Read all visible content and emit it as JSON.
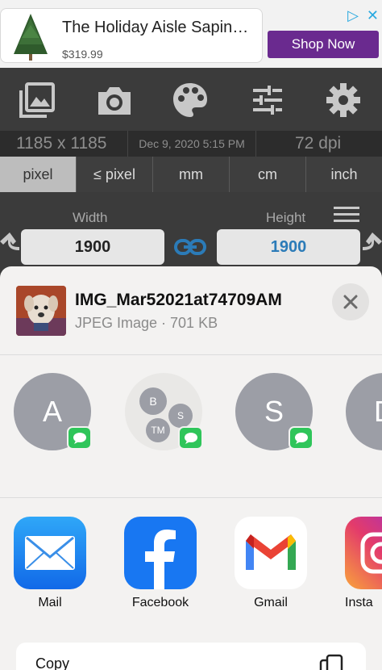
{
  "ad": {
    "title": "The Holiday Aisle Sapin…",
    "price": "$319.99",
    "cta": "Shop Now",
    "choices_icon": "adchoices-icon",
    "close_icon": "close-icon"
  },
  "toolbar": {
    "icons": [
      "gallery-icon",
      "camera-icon",
      "palette-icon",
      "sliders-icon",
      "gear-icon"
    ]
  },
  "info": {
    "dimensions": "1185 x 1185",
    "date": "Dec 9, 2020 5:15 PM",
    "dpi": "72 dpi"
  },
  "units": {
    "tabs": [
      {
        "label": "pixel",
        "active": true
      },
      {
        "label": "≤ pixel",
        "active": false
      },
      {
        "label": "mm",
        "active": false
      },
      {
        "label": "cm",
        "active": false
      },
      {
        "label": "inch",
        "active": false
      }
    ]
  },
  "size": {
    "width_label": "Width",
    "height_label": "Height",
    "width_value": "1900",
    "height_value": "1900"
  },
  "share": {
    "file_name": "IMG_Mar52021at74709AM",
    "file_info": "JPEG Image · 701 KB",
    "contacts": [
      {
        "letter": "A"
      },
      {
        "group": [
          "B",
          "S",
          "TM"
        ]
      },
      {
        "letter": "S"
      },
      {
        "letter": "D"
      }
    ],
    "apps": [
      {
        "label": "Mail"
      },
      {
        "label": "Facebook"
      },
      {
        "label": "Gmail"
      },
      {
        "label": "Insta"
      }
    ],
    "action_label": "Copy"
  },
  "colors": {
    "accent_blue": "#2b7bb8",
    "ad_button": "#6a2a8f",
    "message_green": "#2fc55a"
  }
}
